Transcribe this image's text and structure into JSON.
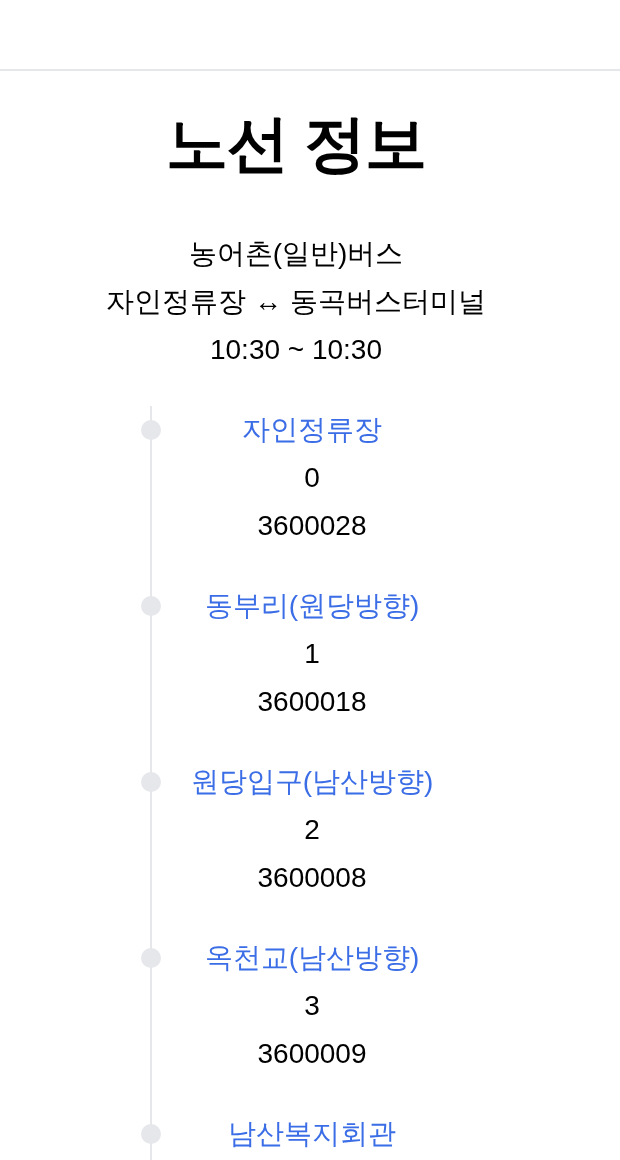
{
  "page_title": "노선 정보",
  "route": {
    "bus_type": "농어촌(일반)버스",
    "endpoints": "자인정류장 ↔ 동곡버스터미널",
    "operating_hours": "10:30 ~ 10:30"
  },
  "stops": [
    {
      "name": "자인정류장",
      "sequence": "0",
      "stop_id": "3600028"
    },
    {
      "name": "동부리(원당방향)",
      "sequence": "1",
      "stop_id": "3600018"
    },
    {
      "name": "원당입구(남산방향)",
      "sequence": "2",
      "stop_id": "3600008"
    },
    {
      "name": "옥천교(남산방향)",
      "sequence": "3",
      "stop_id": "3600009"
    },
    {
      "name": "남산복지회관"
    }
  ]
}
